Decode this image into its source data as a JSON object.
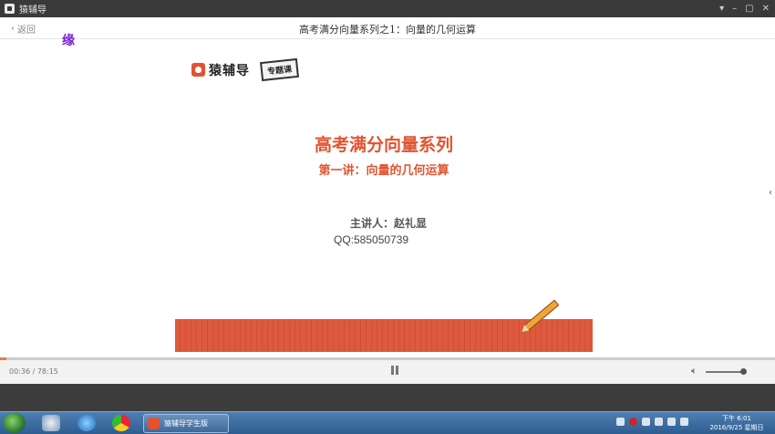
{
  "window": {
    "title": "猿辅导",
    "controls": [
      "▾",
      "–",
      "▢",
      "✕"
    ]
  },
  "nav": {
    "back_label": "返回",
    "lesson_title": "高考满分向量系列之1：向量的几何运算"
  },
  "slide": {
    "watermark": "缘",
    "brand_name": "猿辅导",
    "brand_tag": "专题课",
    "main_title": "高考满分向量系列",
    "sub_title": "第一讲：向量的几何运算",
    "presenter": "主讲人：赵礼显",
    "qq": "QQ:585050739"
  },
  "player": {
    "current_time": "00:36",
    "total_time": "78:15",
    "time_display": "00:36 / 78:15",
    "progress_fraction": 0.0077,
    "volume_fraction": 1.0
  },
  "taskbar": {
    "active_task_label": "猿辅导学生版",
    "clock_time": "下午 6:01",
    "clock_date": "2016/9/25 星期日"
  },
  "colors": {
    "accent": "#e2532f",
    "titlebar": "#3a3a3a",
    "watermark": "#7b1fd4"
  }
}
